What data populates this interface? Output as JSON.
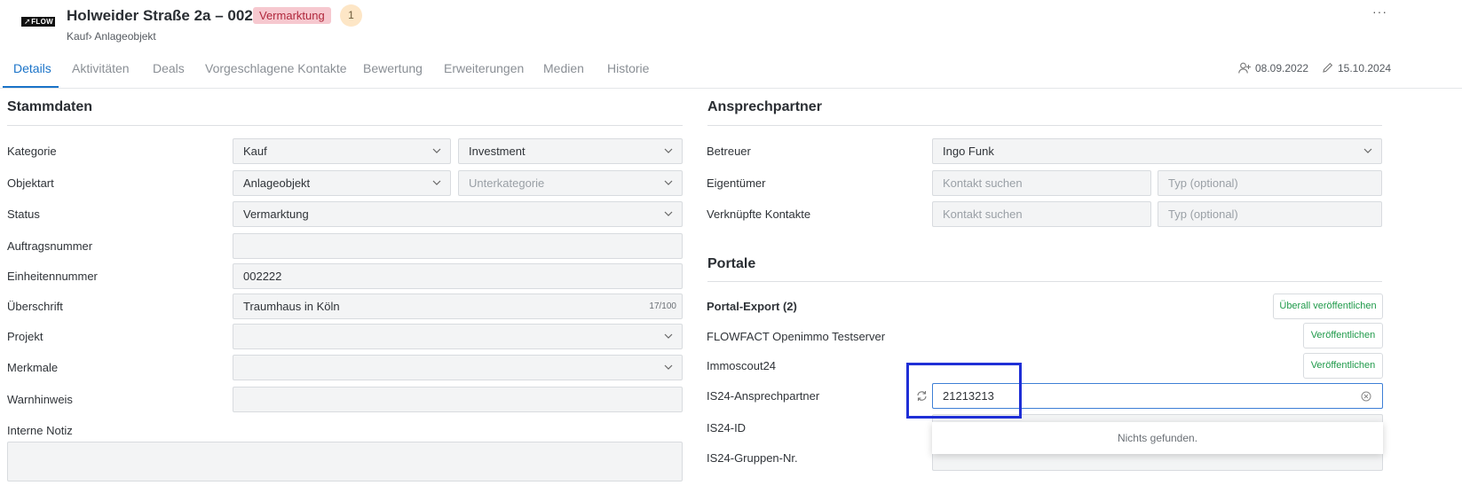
{
  "header": {
    "logo_text": "FLOW",
    "title": "Holweider Straße 2a – 002222",
    "status_badge": "Vermarktung",
    "count_badge": "1",
    "subtitle": "Kauf› Anlageobjekt",
    "more_label": "···"
  },
  "tabs": [
    "Details",
    "Aktivitäten",
    "Deals",
    "Vorgeschlagene Kontakte",
    "Bewertung",
    "Erweiterungen",
    "Medien",
    "Historie"
  ],
  "meta": {
    "created": "08.09.2022",
    "edited": "15.10.2024"
  },
  "stammdaten": {
    "title": "Stammdaten",
    "kategorie": {
      "label": "Kategorie",
      "value1": "Kauf",
      "value2": "Investment"
    },
    "objektart": {
      "label": "Objektart",
      "value1": "Anlageobjekt",
      "placeholder2": "Unterkategorie"
    },
    "status": {
      "label": "Status",
      "value": "Vermarktung"
    },
    "auftragsnummer": {
      "label": "Auftragsnummer",
      "value": ""
    },
    "einheitennummer": {
      "label": "Einheitennummer",
      "value": "002222"
    },
    "ueberschrift": {
      "label": "Überschrift",
      "value": "Traumhaus in Köln",
      "counter": "17/100"
    },
    "projekt": {
      "label": "Projekt",
      "value": ""
    },
    "merkmale": {
      "label": "Merkmale",
      "value": ""
    },
    "warnhinweis": {
      "label": "Warnhinweis",
      "value": ""
    },
    "interne_notiz": {
      "label": "Interne Notiz",
      "value": ""
    }
  },
  "ansprechpartner": {
    "title": "Ansprechpartner",
    "betreuer": {
      "label": "Betreuer",
      "value": "Ingo Funk"
    },
    "eigentuemer": {
      "label": "Eigentümer",
      "placeholder1": "Kontakt suchen",
      "placeholder2": "Typ (optional)"
    },
    "verknuepfte": {
      "label": "Verknüpfte Kontakte",
      "placeholder1": "Kontakt suchen",
      "placeholder2": "Typ (optional)"
    }
  },
  "portale": {
    "title": "Portale",
    "export_label": "Portal-Export (2)",
    "publish_all": "Überall veröffentlichen",
    "items": [
      {
        "label": "FLOWFACT Openimmo Testserver",
        "button": "Veröffentlichen"
      },
      {
        "label": "Immoscout24",
        "button": "Veröffentlichen"
      }
    ],
    "is24_ansprechpartner": {
      "label": "IS24-Ansprechpartner",
      "value": "21213213"
    },
    "is24_id": {
      "label": "IS24-ID"
    },
    "is24_gruppen": {
      "label": "IS24-Gruppen-Nr."
    },
    "dropdown_message": "Nichts gefunden."
  }
}
